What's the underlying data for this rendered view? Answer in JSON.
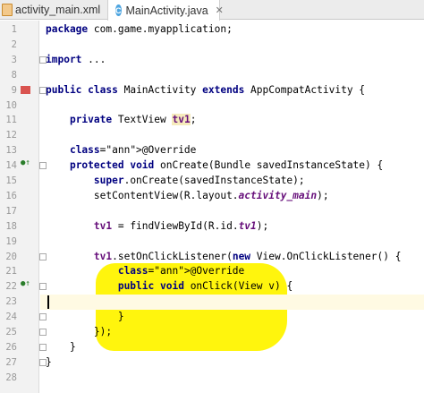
{
  "tabs": [
    {
      "label": "activity_main.xml",
      "active": false
    },
    {
      "label": "MainActivity.java",
      "active": true
    }
  ],
  "editor": {
    "current_line": 23,
    "highlight_color": "#fff400",
    "lines": [
      {
        "n": "1",
        "text": "package com.game.myapplication;"
      },
      {
        "n": "2",
        "text": ""
      },
      {
        "n": "3",
        "text": "import ..."
      },
      {
        "n": "8",
        "text": ""
      },
      {
        "n": "9",
        "text": "public class MainActivity extends AppCompatActivity {"
      },
      {
        "n": "10",
        "text": ""
      },
      {
        "n": "11",
        "text": "    private TextView tv1;"
      },
      {
        "n": "12",
        "text": ""
      },
      {
        "n": "13",
        "text": "    @Override"
      },
      {
        "n": "14",
        "text": "    protected void onCreate(Bundle savedInstanceState) {"
      },
      {
        "n": "15",
        "text": "        super.onCreate(savedInstanceState);"
      },
      {
        "n": "16",
        "text": "        setContentView(R.layout.activity_main);"
      },
      {
        "n": "17",
        "text": ""
      },
      {
        "n": "18",
        "text": "        tv1 = findViewById(R.id.tv1);"
      },
      {
        "n": "19",
        "text": ""
      },
      {
        "n": "20",
        "text": "        tv1.setOnClickListener(new View.OnClickListener() {"
      },
      {
        "n": "21",
        "text": "            @Override"
      },
      {
        "n": "22",
        "text": "            public void onClick(View v) {"
      },
      {
        "n": "23",
        "text": ""
      },
      {
        "n": "24",
        "text": "            }"
      },
      {
        "n": "25",
        "text": "        });"
      },
      {
        "n": "26",
        "text": "    }"
      },
      {
        "n": "27",
        "text": "}"
      },
      {
        "n": "28",
        "text": ""
      }
    ]
  }
}
